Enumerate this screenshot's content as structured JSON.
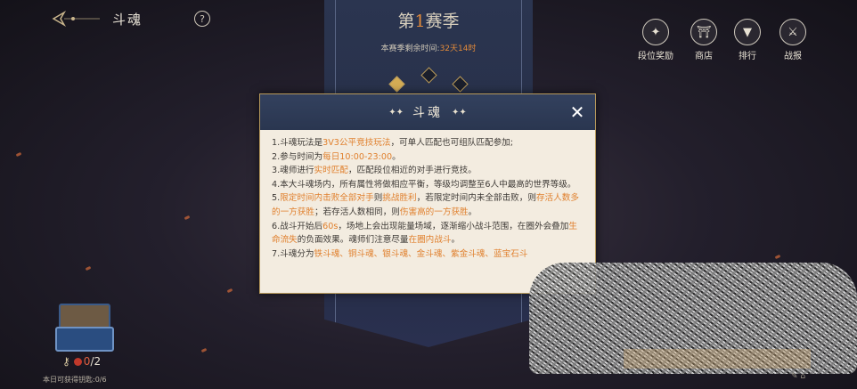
{
  "header": {
    "back_icon": "back-arrow-icon",
    "title": "斗魂",
    "help_label": "?"
  },
  "season": {
    "prefix": "第",
    "number": "1",
    "suffix": "赛季",
    "remaining_label": "本赛季剩余时间:",
    "remaining_value": "32天14时"
  },
  "nav": [
    {
      "label": "段位奖励",
      "icon": "rank-reward-icon",
      "glyph": "✦"
    },
    {
      "label": "商店",
      "icon": "shop-icon",
      "glyph": "⛩"
    },
    {
      "label": "排行",
      "icon": "ranking-icon",
      "glyph": "▼"
    },
    {
      "label": "战报",
      "icon": "battle-report-icon",
      "glyph": "⚔"
    }
  ],
  "dialog": {
    "title": "斗魂",
    "close_label": "✕",
    "rules": [
      [
        {
          "t": "1.斗魂玩法是"
        },
        {
          "t": "3V3公平竞技玩法",
          "h": true
        },
        {
          "t": "，可单人匹配也可组队匹配参加;"
        }
      ],
      [
        {
          "t": "2.参与时间为"
        },
        {
          "t": "每日10:00-23:00",
          "h": true
        },
        {
          "t": "。"
        }
      ],
      [
        {
          "t": "3.魂师进行"
        },
        {
          "t": "实时匹配",
          "h": true
        },
        {
          "t": "，匹配段位相近的对手进行竞技。"
        }
      ],
      [
        {
          "t": "4.本大斗魂场内，所有属性将做相应平衡，等级均调整至6人中最高的世界等级。"
        }
      ],
      [
        {
          "t": "5."
        },
        {
          "t": "限定时间内击败全部对手",
          "h": true
        },
        {
          "t": "则"
        },
        {
          "t": "挑战胜利",
          "h": true
        },
        {
          "t": "，若限定时间内未全部击败，则"
        },
        {
          "t": "存活人数多的一方获胜",
          "h": true
        },
        {
          "t": "；若存活人数相同，则"
        },
        {
          "t": "伤害高的一方获胜",
          "h": true
        },
        {
          "t": "。"
        }
      ],
      [
        {
          "t": "6.战斗开始后"
        },
        {
          "t": "60s",
          "h": true
        },
        {
          "t": "，场地上会出现能量场域，逐渐缩小战斗范围，在圈外会叠加"
        },
        {
          "t": "生命流失",
          "h": true
        },
        {
          "t": "的负面效果。魂师们注意尽量"
        },
        {
          "t": "在圈内战斗",
          "h": true
        },
        {
          "t": "。"
        }
      ],
      [
        {
          "t": "7.斗魂分为"
        },
        {
          "t": "铁斗魂、铜斗魂、银斗魂、金斗魂、紫金斗魂、蓝宝石斗",
          "h": true
        }
      ]
    ]
  },
  "bottom": {
    "chest_icon": "treasure-chest-icon",
    "key_icon": "key-icon",
    "keys_count": "0",
    "keys_total": "/2",
    "daily_label": "本日可获得钥匙:0/6"
  },
  "colors": {
    "highlight": "#e0802e",
    "dialog_bg": "#f3ece0",
    "header_bg": "#2f3c58"
  }
}
